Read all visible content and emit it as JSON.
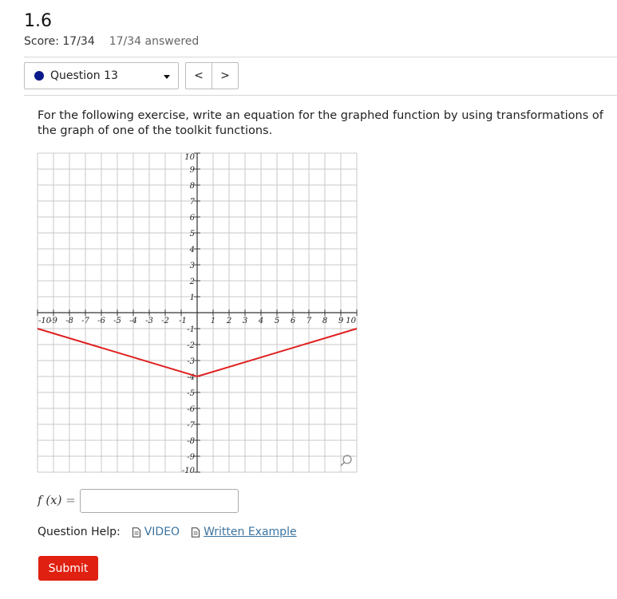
{
  "header": {
    "title": "1.6",
    "score": "Score: 17/34",
    "answered": "17/34 answered"
  },
  "question_nav": {
    "selected": "Question 13",
    "prev_label": "<",
    "next_label": ">"
  },
  "prompt": "For the following exercise, write an equation for the graphed function by using transformations of the graph of one of the toolkit functions.",
  "answer": {
    "label_fx": "f (x)",
    "label_eq": "=",
    "value": "",
    "placeholder": ""
  },
  "help": {
    "label": "Question Help:",
    "video_label": "VIDEO",
    "written_label": " Written Example"
  },
  "submit_label": "Submit",
  "colors": {
    "line": "#e02020",
    "submit": "#e02010",
    "link": "#3b73a0",
    "dot": "#0a1a8a"
  },
  "chart_data": {
    "type": "line",
    "xlim": [
      -10,
      10
    ],
    "ylim": [
      -10,
      10
    ],
    "grid": true,
    "x_ticks": [
      -10,
      -9,
      -8,
      -7,
      -6,
      -5,
      -4,
      -3,
      -2,
      -1,
      1,
      2,
      3,
      4,
      5,
      6,
      7,
      8,
      9,
      10
    ],
    "y_ticks": [
      -10,
      -9,
      -8,
      -7,
      -6,
      -5,
      -4,
      -3,
      -2,
      -1,
      1,
      2,
      3,
      4,
      5,
      6,
      7,
      8,
      9,
      10
    ],
    "series": [
      {
        "x": [
          -10,
          0,
          10
        ],
        "y": [
          -1,
          -4,
          -1
        ]
      }
    ]
  }
}
